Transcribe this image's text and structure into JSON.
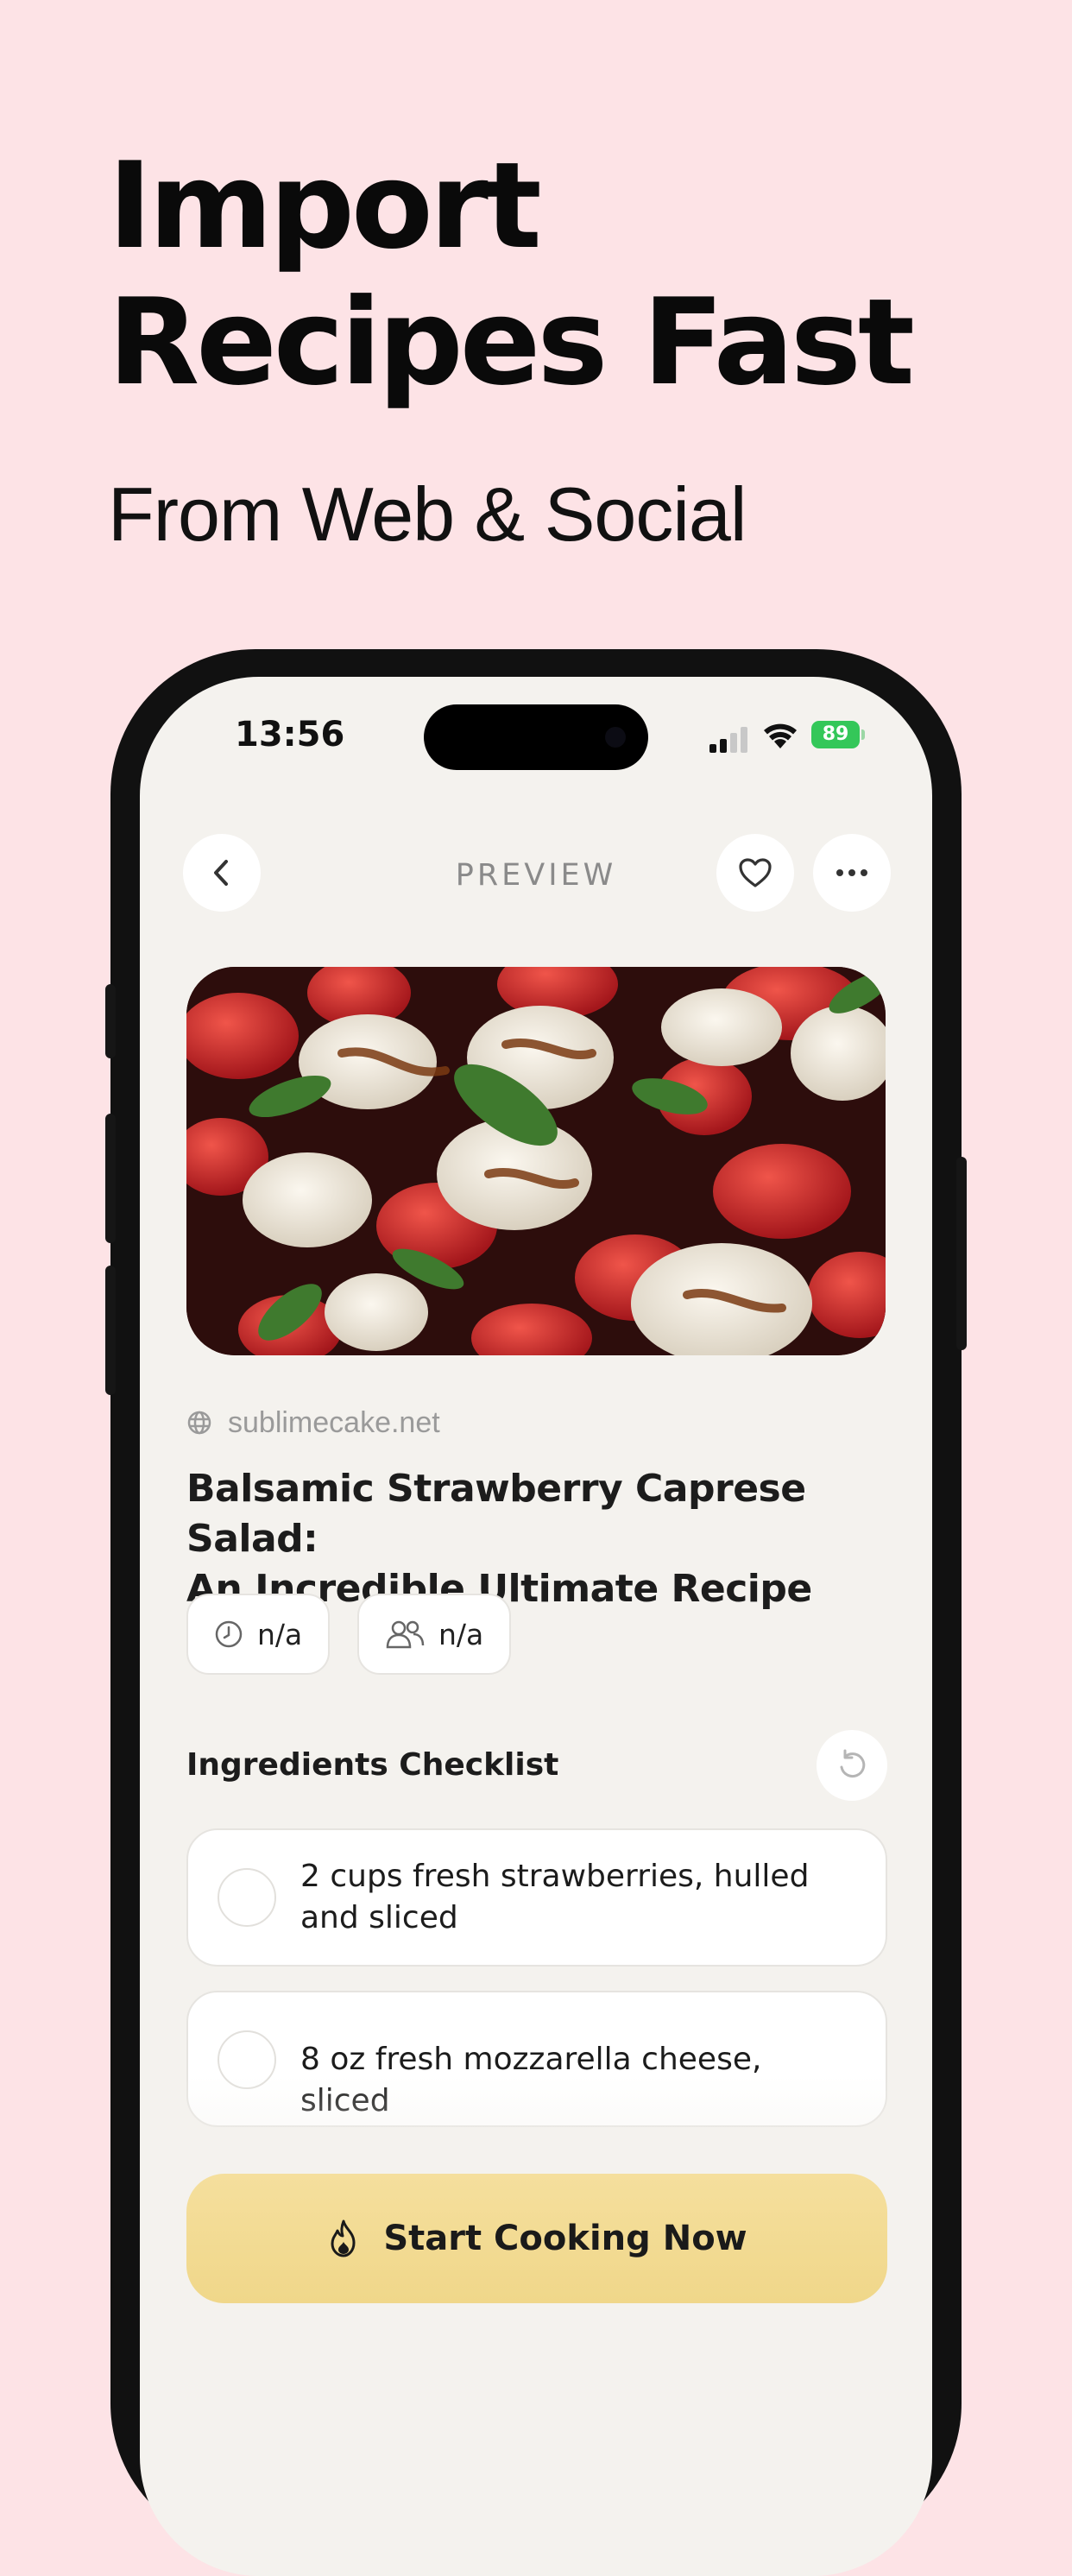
{
  "headline": {
    "line1": "Import",
    "line2": "Recipes Fast"
  },
  "subhead": "From Web & Social",
  "status_bar": {
    "time": "13:56",
    "battery": "89"
  },
  "nav": {
    "title": "PREVIEW",
    "back_icon": "chevron-left-icon",
    "favorite_icon": "heart-icon",
    "more_icon": "ellipsis-icon"
  },
  "recipe": {
    "source": "sublimecake.net",
    "title_line1": "Balsamic Strawberry Caprese Salad:",
    "title_line2": "An Incredible Ultimate Recipe",
    "time": "n/a",
    "servings": "n/a"
  },
  "ingredients": {
    "title": "Ingredients Checklist",
    "items": [
      {
        "line1": "2 cups fresh strawberries, hulled",
        "line2": "and sliced"
      },
      {
        "line1": "8 oz fresh mozzarella cheese, sliced",
        "line2": ""
      }
    ]
  },
  "cta": {
    "label": "Start Cooking Now",
    "icon": "flame-icon"
  },
  "colors": {
    "background": "#fde3e6",
    "screen": "#f4f2ee",
    "cta": "#f2da90",
    "battery": "#34c759"
  }
}
